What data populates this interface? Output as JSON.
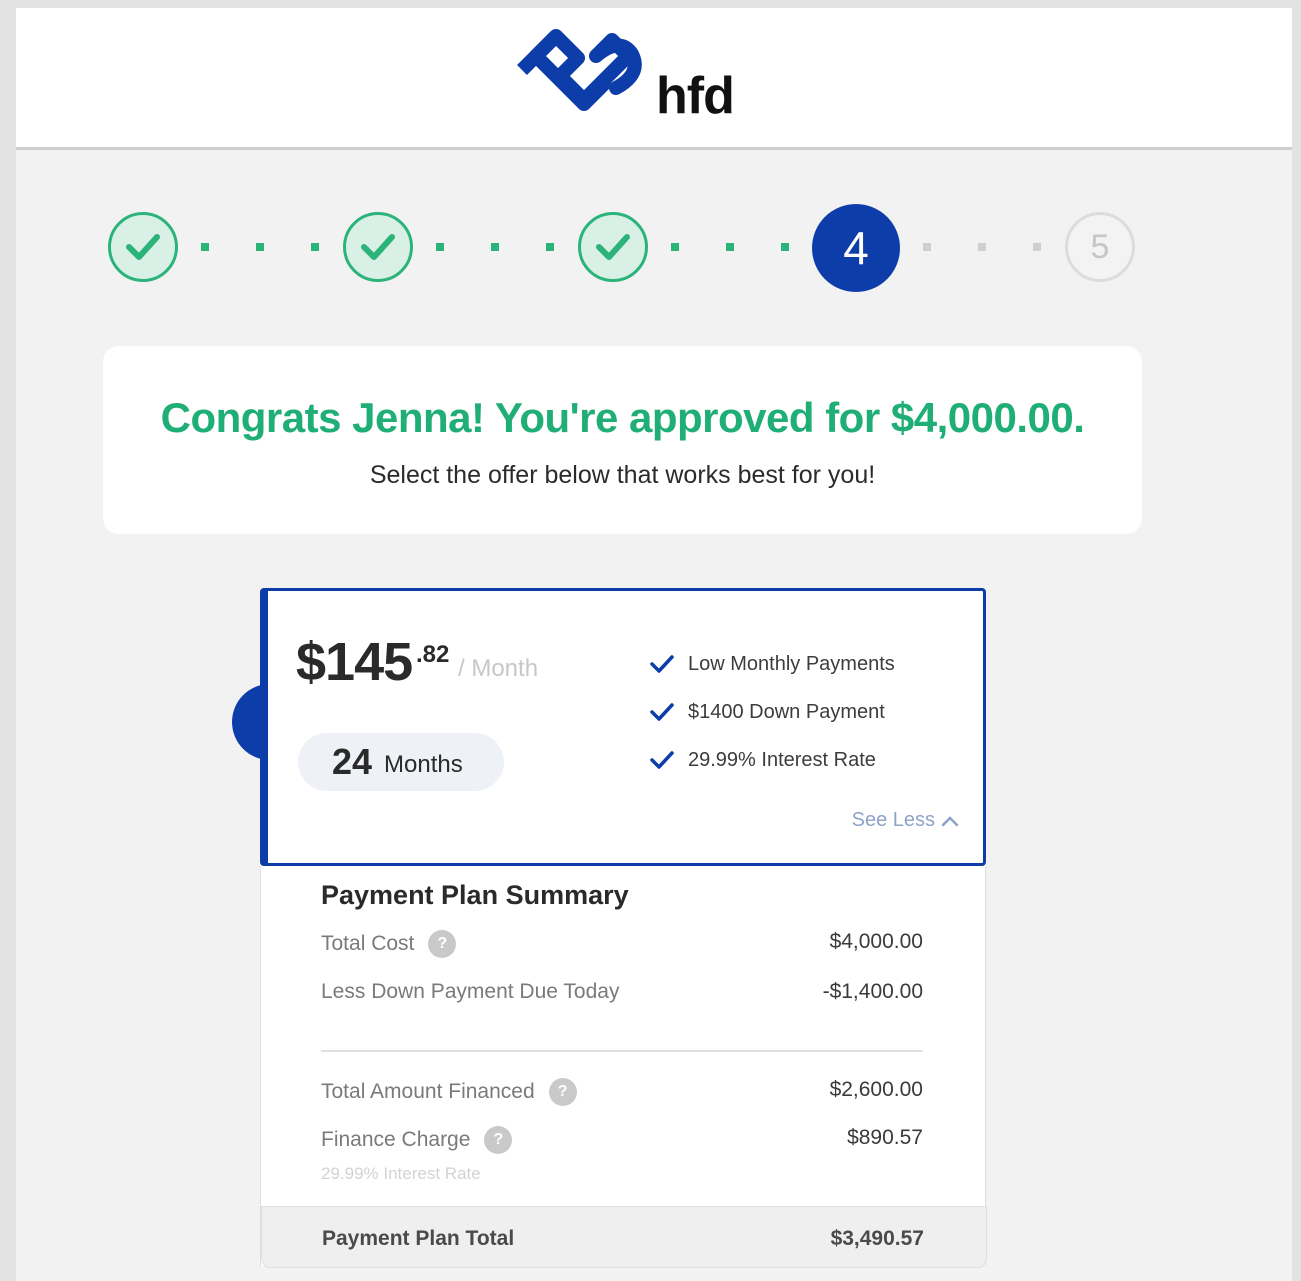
{
  "brand": {
    "name": "hfd",
    "color": "#0d3da8"
  },
  "stepper": {
    "steps": [
      {
        "state": "done",
        "icon": "check-icon"
      },
      {
        "state": "done",
        "icon": "check-icon"
      },
      {
        "state": "done",
        "icon": "check-icon"
      },
      {
        "state": "current",
        "label": "4"
      },
      {
        "state": "future",
        "label": "5"
      }
    ],
    "done_color": "#2bb37a"
  },
  "congrats": {
    "headline": "Congrats Jenna! You're approved for $4,000.00.",
    "subtext": "Select the offer below that works best for you!"
  },
  "offer": {
    "price_dollars": "$145",
    "price_cents": ".82",
    "per_label": "/ Month",
    "months_number": "24",
    "months_label": "Months",
    "features": [
      "Low Monthly Payments",
      "$1400 Down Payment",
      "29.99% Interest Rate"
    ],
    "see_less_label": "See Less"
  },
  "summary": {
    "title": "Payment Plan Summary",
    "rows": [
      {
        "label": "Total Cost",
        "value": "$4,000.00",
        "help": true
      },
      {
        "label": "Less Down Payment Due Today",
        "value": "-$1,400.00",
        "help": false
      },
      {
        "label": "Total Amount Financed",
        "value": "$2,600.00",
        "help": true
      },
      {
        "label": "Finance Charge",
        "value": "$890.57",
        "help": true
      }
    ],
    "finance_note": "29.99% Interest Rate",
    "total_label": "Payment Plan Total",
    "total_value": "$3,490.57"
  },
  "help_icon_glyph": "?"
}
